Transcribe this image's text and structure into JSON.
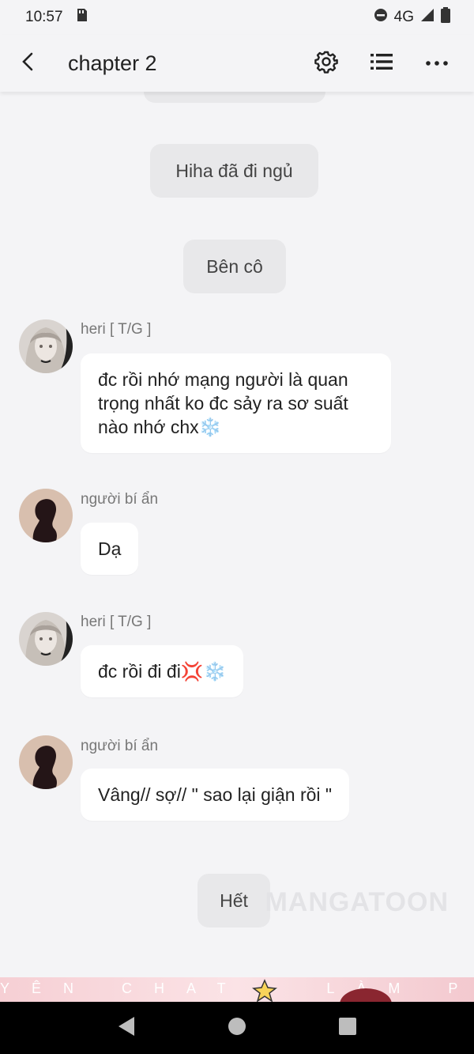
{
  "status_bar": {
    "time": "10:57",
    "network": "4G"
  },
  "app_bar": {
    "title": "chapter 2",
    "icons": [
      "back-arrow-icon",
      "settings-gear-icon",
      "list-icon",
      "more-options-icon"
    ]
  },
  "chat": {
    "narrations": [
      {
        "text": "Hiha đã đi ngủ"
      },
      {
        "text": "Bên cô"
      }
    ],
    "messages": [
      {
        "speaker": "heri [ T/G ]",
        "text": "đc rồi nhớ mạng người là quan trọng nhất ko đc sảy ra sơ suất nào nhớ chx❄️"
      },
      {
        "speaker": "người bí ẩn",
        "text": "Dạ"
      },
      {
        "speaker": "heri [ T/G ]",
        "text": "đc rồi đi đi💢❄️"
      },
      {
        "speaker": "người bí ẩn",
        "text": "Vâng// sợ// \" sao lại giận rồi \""
      }
    ],
    "end_label": "Hết",
    "watermark": "MANGATOON"
  },
  "banner": {
    "text": "YÊN CHAT · LÀM PHA"
  },
  "colors": {
    "background": "#f4f4f6",
    "bubble": "#ffffff",
    "narration": "#e8e8ea",
    "banner": "#f6cfd4"
  }
}
